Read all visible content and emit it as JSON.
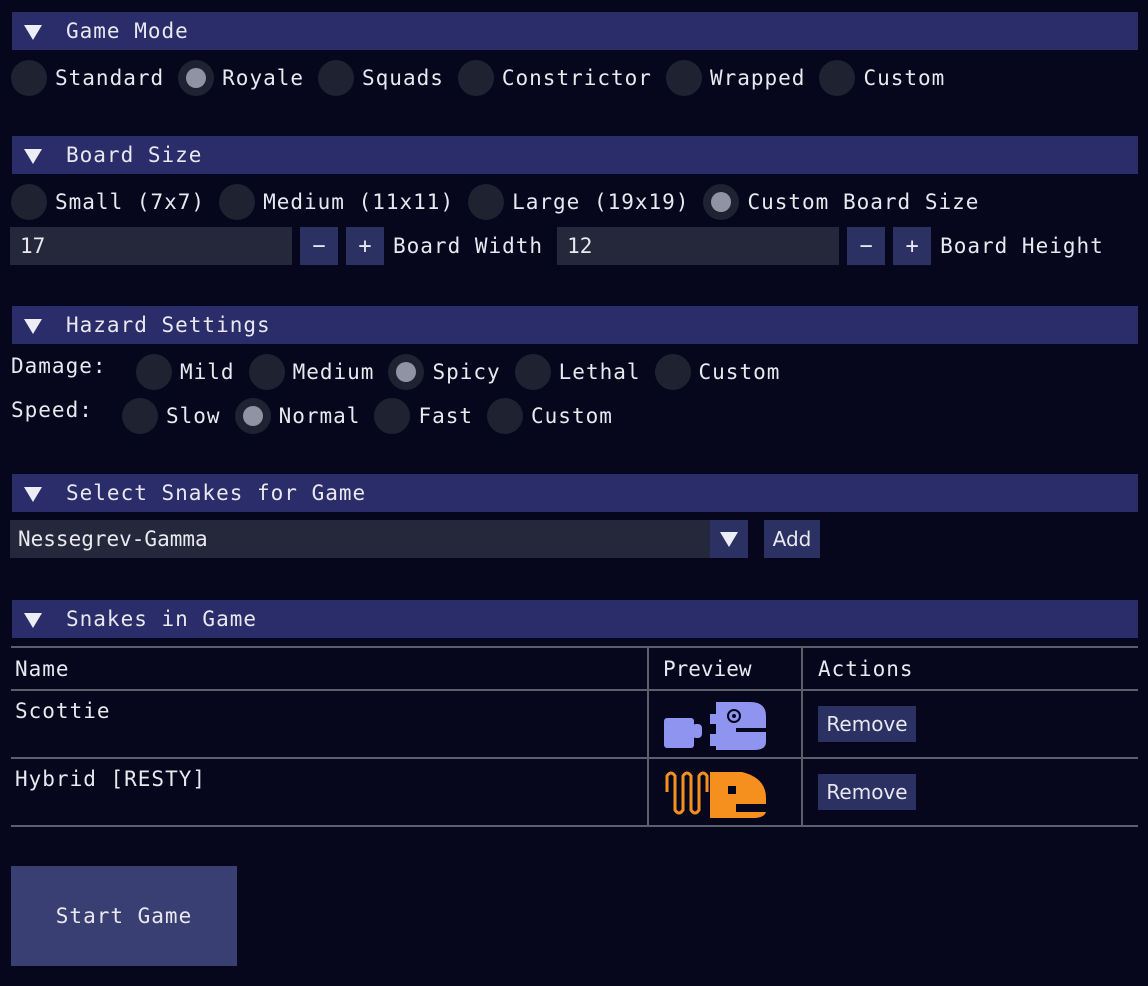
{
  "sections": {
    "game_mode": "Game Mode",
    "board_size": "Board Size",
    "hazard": "Hazard Settings",
    "select_snakes": "Select Snakes for Game",
    "snakes_in_game": "Snakes in Game"
  },
  "game_mode": {
    "options": [
      "Standard",
      "Royale",
      "Squads",
      "Constrictor",
      "Wrapped",
      "Custom"
    ],
    "selected": "Royale"
  },
  "board_size": {
    "options": [
      "Small (7x7)",
      "Medium (11x11)",
      "Large (19x19)",
      "Custom Board Size"
    ],
    "selected": "Custom Board Size",
    "width_value": "17",
    "width_label": "Board Width",
    "height_value": "12",
    "height_label": "Board Height",
    "minus": "−",
    "plus": "+"
  },
  "hazard": {
    "damage_label": "Damage:",
    "damage_options": [
      "Mild",
      "Medium",
      "Spicy",
      "Lethal",
      "Custom"
    ],
    "damage_selected": "Spicy",
    "speed_label": "Speed:",
    "speed_options": [
      "Slow",
      "Normal",
      "Fast",
      "Custom"
    ],
    "speed_selected": "Normal"
  },
  "select_snakes": {
    "dropdown_value": "Nessegrev-Gamma",
    "add_label": "Add"
  },
  "table": {
    "headers": [
      "Name",
      "Preview",
      "Actions"
    ],
    "rows": [
      {
        "name": "Scottie",
        "action": "Remove",
        "color": "#8e94f0"
      },
      {
        "name": "Hybrid [RESTY]",
        "action": "Remove",
        "color": "#f5901e"
      }
    ]
  },
  "start_label": "Start Game",
  "colors": {
    "background": "#06071d",
    "header": "#2b2d6b",
    "button": "#2c3163",
    "start_button": "#3a3f73"
  }
}
